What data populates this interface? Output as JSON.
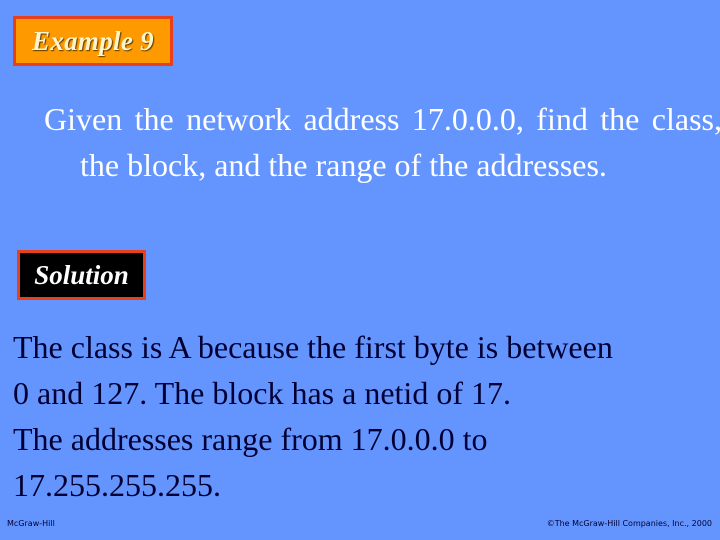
{
  "slide": {
    "title": "Example 9",
    "problem": "Given the network address 17.0.0.0, find the class, the block, and the range of the addresses.",
    "solution_label": "Solution",
    "answer_lines": [
      "The class is A because the first byte is between",
      "0 and 127. The block has a netid of 17.",
      "The addresses range from 17.0.0.0 to",
      "17.255.255.255."
    ]
  },
  "footer": {
    "publisher": "McGraw-Hill",
    "copyright": "©The McGraw-Hill Companies, Inc., 2000"
  },
  "colors": {
    "background": "#6495ff",
    "title_box_fill": "#ff9900",
    "box_border": "#e8401c",
    "solution_box_fill": "#000000",
    "problem_text": "#ffffff",
    "answer_text": "#000033"
  }
}
